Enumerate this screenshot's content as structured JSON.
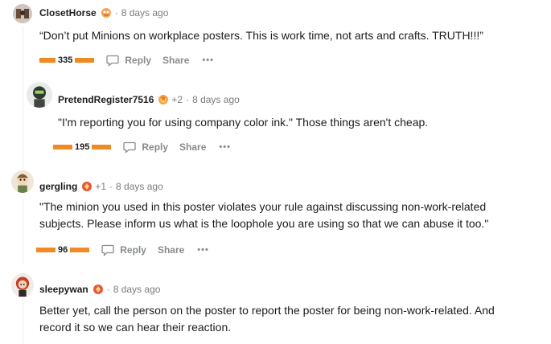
{
  "comments": [
    {
      "username": "ClosetHorse",
      "award_count": "",
      "time": "8 days ago",
      "body": "“Don’t put Minions on workplace posters. This is work time, not arts and crafts. TRUTH!!!”",
      "votes": "335",
      "reply": "Reply",
      "share": "Share",
      "more": "•••"
    },
    {
      "username": "PretendRegister7516",
      "award_count": "+2",
      "time": "8 days ago",
      "body": "\"I'm reporting you for using company color ink.\" Those things aren't cheap.",
      "votes": "195",
      "reply": "Reply",
      "share": "Share",
      "more": "•••"
    },
    {
      "username": "gergling",
      "award_count": "+1",
      "time": "8 days ago",
      "body_lines": [
        "\"The minion you used in this poster violates your rule against discussing non-work-related",
        "subjects. Please inform us what is the loophole you are using so that we can abuse it too.\""
      ],
      "votes": "96",
      "reply": "Reply",
      "share": "Share",
      "more": "•••"
    },
    {
      "username": "sleepywan",
      "award_count": "",
      "time": "8 days ago",
      "body_lines": [
        "Better yet, call the person on the poster to report the poster for being non-work-related. And",
        "record it so we can hear their reaction."
      ]
    }
  ],
  "separator": "·",
  "colors": {
    "vote": "#f08a24",
    "meta": "#7c7c7c",
    "text": "#1c1c1c",
    "action": "#878a8c"
  },
  "icons": {
    "reply": "comment-bubble-icon",
    "award": "award-icon"
  }
}
